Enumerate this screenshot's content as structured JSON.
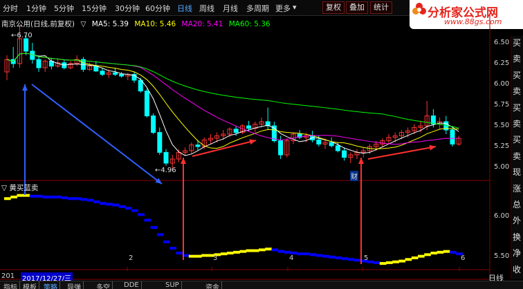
{
  "toolbar": {
    "periods": [
      "分时",
      "1分钟",
      "5分钟",
      "15分钟",
      "30分钟",
      "60分钟",
      "日线",
      "周线",
      "月线",
      "多周期",
      "更多"
    ],
    "active_period": "日线",
    "buttons": [
      "复权",
      "叠加",
      "统计"
    ]
  },
  "logo": {
    "title": "分析家公式网",
    "url": "www.88gs.com"
  },
  "chart_header": {
    "stock": "南京公用(日线,前复权)",
    "ma5": "MA5: 5.39",
    "ma10": "MA10: 5.46",
    "ma20": "MA20: 5.41",
    "ma60": "MA60: 5.36"
  },
  "indicator": {
    "name": "黄买蓝卖"
  },
  "annotations": {
    "high": "6.70",
    "low": "4.96",
    "marker": "财"
  },
  "side_tabs": [
    "买",
    "卖",
    "买",
    "卖",
    "买",
    "卖",
    "买",
    "卖",
    "现",
    "涨",
    "总",
    "外",
    "换",
    "净",
    "收"
  ],
  "bottom": {
    "year": "201",
    "date": "2017/12/27/三",
    "period": "日线",
    "tabs": [
      "指标",
      "模板",
      "策略",
      "导弹",
      "多空",
      "DDE",
      "SUP",
      "资金"
    ]
  },
  "colors": {
    "up": "#ff3333",
    "down": "#00ffff",
    "ma5": "#ffffff",
    "ma10": "#ffff00",
    "ma20": "#ff00ff",
    "ma60": "#00ff00",
    "buy": "#ffff00",
    "sell": "#0000ff",
    "arrow_red": "#ff3030",
    "arrow_blue": "#3060ff"
  },
  "chart_data": [
    {
      "type": "candlestick",
      "title": "南京公用(日线,前复权)",
      "ylim": [
        4.85,
        6.65
      ],
      "yticks": [
        5.0,
        5.25,
        5.5,
        5.75,
        6.0,
        6.25,
        6.5
      ],
      "xticks": [
        "2",
        "3",
        "4",
        "5",
        "6"
      ],
      "candles": [
        [
          6.15,
          6.35,
          6.05,
          6.3
        ],
        [
          6.3,
          6.45,
          6.2,
          6.25
        ],
        [
          6.25,
          6.7,
          6.2,
          6.55
        ],
        [
          6.55,
          6.6,
          6.35,
          6.4
        ],
        [
          6.4,
          6.5,
          6.25,
          6.3
        ],
        [
          6.3,
          6.35,
          6.15,
          6.2
        ],
        [
          6.2,
          6.3,
          6.15,
          6.28
        ],
        [
          6.28,
          6.32,
          6.18,
          6.22
        ],
        [
          6.22,
          6.3,
          6.2,
          6.26
        ],
        [
          6.26,
          6.3,
          6.18,
          6.2
        ],
        [
          6.2,
          6.28,
          6.18,
          6.25
        ],
        [
          6.25,
          6.35,
          6.22,
          6.3
        ],
        [
          6.3,
          6.33,
          6.15,
          6.18
        ],
        [
          6.18,
          6.26,
          6.16,
          6.22
        ],
        [
          6.22,
          6.28,
          6.15,
          6.16
        ],
        [
          6.16,
          6.2,
          6.1,
          6.12
        ],
        [
          6.12,
          6.18,
          6.08,
          6.14
        ],
        [
          6.14,
          6.2,
          6.1,
          6.12
        ],
        [
          6.12,
          6.15,
          6.08,
          6.1
        ],
        [
          6.1,
          6.14,
          6.05,
          6.12
        ],
        [
          6.12,
          6.15,
          6.02,
          6.05
        ],
        [
          6.05,
          6.08,
          5.9,
          5.92
        ],
        [
          5.92,
          5.95,
          5.6,
          5.62
        ],
        [
          5.62,
          5.65,
          5.4,
          5.42
        ],
        [
          5.42,
          5.48,
          5.15,
          5.18
        ],
        [
          5.18,
          5.22,
          5.02,
          5.05
        ],
        [
          5.05,
          5.15,
          4.96,
          5.1
        ],
        [
          5.1,
          5.22,
          5.06,
          5.18
        ],
        [
          5.18,
          5.24,
          5.14,
          5.2
        ],
        [
          5.2,
          5.3,
          5.16,
          5.27
        ],
        [
          5.27,
          5.33,
          5.2,
          5.25
        ],
        [
          5.25,
          5.36,
          5.22,
          5.33
        ],
        [
          5.33,
          5.4,
          5.28,
          5.35
        ],
        [
          5.35,
          5.42,
          5.3,
          5.38
        ],
        [
          5.38,
          5.45,
          5.33,
          5.4
        ],
        [
          5.4,
          5.48,
          5.36,
          5.46
        ],
        [
          5.46,
          5.5,
          5.38,
          5.42
        ],
        [
          5.42,
          5.52,
          5.4,
          5.5
        ],
        [
          5.5,
          5.56,
          5.44,
          5.47
        ],
        [
          5.47,
          5.55,
          5.42,
          5.52
        ],
        [
          5.52,
          5.6,
          5.48,
          5.55
        ],
        [
          5.55,
          5.72,
          5.45,
          5.5
        ],
        [
          5.5,
          5.55,
          5.3,
          5.32
        ],
        [
          5.32,
          5.38,
          5.1,
          5.15
        ],
        [
          5.15,
          5.35,
          5.12,
          5.32
        ],
        [
          5.32,
          5.42,
          5.28,
          5.4
        ],
        [
          5.4,
          5.45,
          5.34,
          5.36
        ],
        [
          5.36,
          5.42,
          5.3,
          5.38
        ],
        [
          5.38,
          5.44,
          5.3,
          5.33
        ],
        [
          5.33,
          5.38,
          5.25,
          5.28
        ],
        [
          5.28,
          5.35,
          5.22,
          5.3
        ],
        [
          5.3,
          5.36,
          5.24,
          5.26
        ],
        [
          5.26,
          5.3,
          5.18,
          5.2
        ],
        [
          5.2,
          5.24,
          5.08,
          5.12
        ],
        [
          5.12,
          5.18,
          5.05,
          5.15
        ],
        [
          5.15,
          5.22,
          5.1,
          5.18
        ],
        [
          5.18,
          5.24,
          5.12,
          5.2
        ],
        [
          5.2,
          5.28,
          5.16,
          5.25
        ],
        [
          5.25,
          5.32,
          5.2,
          5.28
        ],
        [
          5.28,
          5.35,
          5.24,
          5.32
        ],
        [
          5.32,
          5.4,
          5.28,
          5.36
        ],
        [
          5.36,
          5.42,
          5.3,
          5.38
        ],
        [
          5.38,
          5.45,
          5.34,
          5.42
        ],
        [
          5.42,
          5.48,
          5.36,
          5.44
        ],
        [
          5.44,
          5.52,
          5.4,
          5.48
        ],
        [
          5.48,
          5.56,
          5.42,
          5.5
        ],
        [
          5.5,
          5.8,
          5.45,
          5.62
        ],
        [
          5.62,
          5.7,
          5.48,
          5.52
        ],
        [
          5.52,
          5.6,
          5.46,
          5.55
        ],
        [
          5.55,
          5.62,
          5.4,
          5.45
        ],
        [
          5.45,
          5.5,
          5.25,
          5.28
        ],
        [
          5.28,
          5.38,
          5.26,
          5.35
        ]
      ]
    },
    {
      "type": "line",
      "title": "黄买蓝卖",
      "ylim": [
        5.35,
        6.3
      ],
      "yticks": [
        5.5,
        6.0
      ],
      "values": [
        6.22,
        6.24,
        6.26,
        6.26,
        6.25,
        6.25,
        6.24,
        6.24,
        6.24,
        6.23,
        6.22,
        6.22,
        6.21,
        6.2,
        6.18,
        6.16,
        6.15,
        6.14,
        6.12,
        6.1,
        6.07,
        6.02,
        5.95,
        5.86,
        5.77,
        5.68,
        5.6,
        5.54,
        5.51,
        5.5,
        5.5,
        5.51,
        5.51,
        5.52,
        5.53,
        5.54,
        5.55,
        5.56,
        5.57,
        5.57,
        5.58,
        5.59,
        5.58,
        5.56,
        5.55,
        5.54,
        5.53,
        5.53,
        5.52,
        5.51,
        5.5,
        5.49,
        5.48,
        5.47,
        5.46,
        5.45,
        5.44,
        5.43,
        5.42,
        5.41,
        5.42,
        5.43,
        5.44,
        5.46,
        5.48,
        5.5,
        5.52,
        5.54,
        5.55,
        5.56,
        5.55,
        5.53
      ],
      "signal": [
        "b",
        "b",
        "b",
        "b",
        "s",
        "s",
        "s",
        "s",
        "s",
        "s",
        "s",
        "s",
        "s",
        "s",
        "s",
        "s",
        "s",
        "s",
        "s",
        "s",
        "s",
        "s",
        "s",
        "s",
        "s",
        "s",
        "s",
        "s",
        "s",
        "b",
        "b",
        "b",
        "b",
        "b",
        "b",
        "b",
        "b",
        "b",
        "b",
        "b",
        "b",
        "b",
        "s",
        "s",
        "s",
        "s",
        "s",
        "s",
        "s",
        "s",
        "s",
        "s",
        "s",
        "s",
        "s",
        "s",
        "s",
        "s",
        "s",
        "b",
        "b",
        "b",
        "b",
        "b",
        "b",
        "b",
        "b",
        "b",
        "b",
        "b",
        "s",
        "s"
      ]
    }
  ]
}
